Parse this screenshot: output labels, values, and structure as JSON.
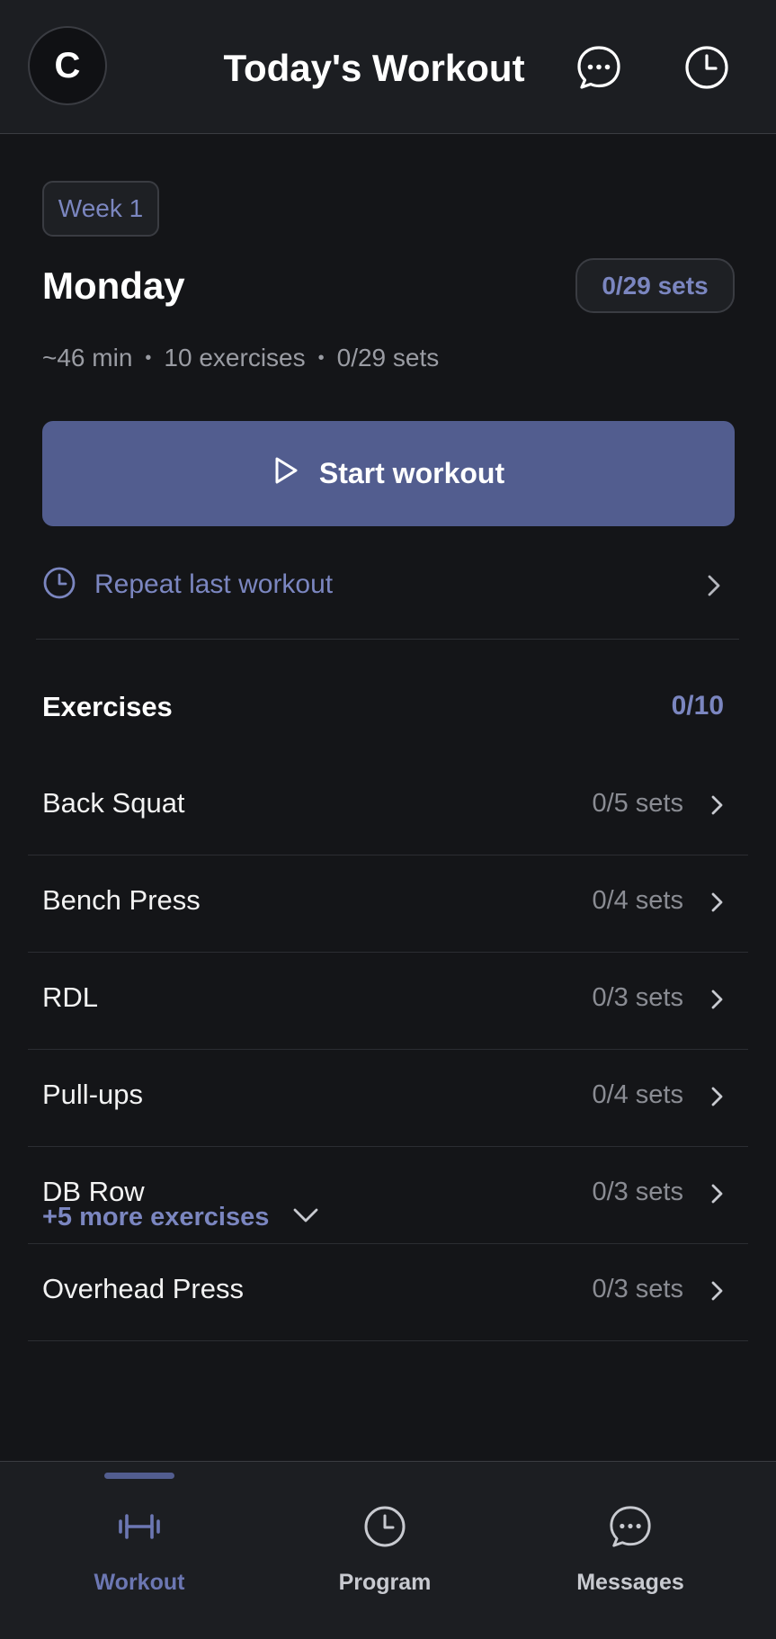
{
  "header": {
    "avatar_initial": "C",
    "title": "Today's Workout",
    "icons": [
      "chat-bubble-icon",
      "clock-icon"
    ]
  },
  "session": {
    "week_label": "Week 1",
    "day": "Monday",
    "sets_badge": "0/29 sets",
    "duration": "~46 min",
    "exercise_count": "10 exercises",
    "sets_progress": "0/29 sets",
    "start_label": "Start workout",
    "repeat_label": "Repeat last workout"
  },
  "exercises": {
    "heading": "Exercises",
    "count": "0/10",
    "items": [
      {
        "name": "Back Squat",
        "sets": "0/5 sets"
      },
      {
        "name": "Bench Press",
        "sets": "0/4 sets"
      },
      {
        "name": "RDL",
        "sets": "0/3 sets"
      },
      {
        "name": "Pull-ups",
        "sets": "0/4 sets"
      },
      {
        "name": "DB Row",
        "sets": "0/3 sets"
      },
      {
        "name": "Overhead Press",
        "sets": "0/3 sets"
      }
    ],
    "more_label": "+5 more exercises"
  },
  "tabs": [
    {
      "label": "Workout",
      "icon": "dumbbell-icon",
      "active": true
    },
    {
      "label": "Program",
      "icon": "clock-icon",
      "active": false
    },
    {
      "label": "Messages",
      "icon": "chat-bubble-icon",
      "active": false
    }
  ],
  "colors": {
    "background": "#141518",
    "surface": "#1c1e22",
    "accent": "#525d8f",
    "accent_text": "#7b86c0",
    "muted_text": "#9a9ca3"
  }
}
